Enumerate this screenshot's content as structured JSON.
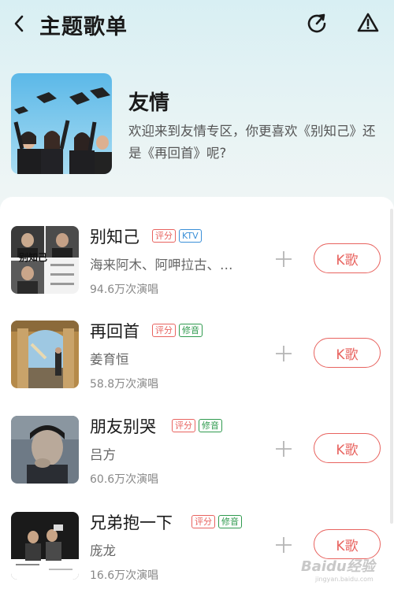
{
  "header": {
    "title": "主题歌单"
  },
  "topic": {
    "title": "友情",
    "description": "欢迎来到友情专区，你更喜欢《别知己》还是《再回首》呢?"
  },
  "songs": [
    {
      "title": "别知己",
      "tags": [
        "评分",
        "KTV"
      ],
      "artist": "海来阿木、阿呷拉古、…",
      "plays": "94.6万次演唱",
      "button": "K歌"
    },
    {
      "title": "再回首",
      "tags": [
        "评分",
        "修音"
      ],
      "artist": "姜育恒",
      "plays": "58.8万次演唱",
      "button": "K歌"
    },
    {
      "title": "朋友别哭",
      "tags": [
        "评分",
        "修音"
      ],
      "artist": "吕方",
      "plays": "60.6万次演唱",
      "button": "K歌"
    },
    {
      "title": "兄弟抱一下",
      "tags": [
        "评分",
        "修音"
      ],
      "artist": "庞龙",
      "plays": "16.6万次演唱",
      "button": "K歌"
    }
  ],
  "cover_text": {
    "song1": "别知己"
  },
  "watermark": {
    "brand": "Baidu经验",
    "url": "jingyan.baidu.com"
  },
  "colors": {
    "accent": "#e8635f",
    "tag_ktv": "#3a8fd8",
    "tag_fix": "#2f9a4e"
  },
  "icons": [
    "back-arrow-icon",
    "share-icon",
    "report-warning-icon",
    "add-plus-icon"
  ]
}
